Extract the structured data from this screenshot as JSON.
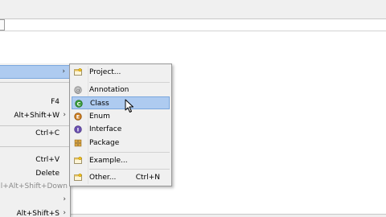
{
  "context_menu": {
    "items": [
      {
        "label": "",
        "has_submenu": true,
        "highlighted": true
      },
      {
        "label": "F4",
        "has_submenu": false
      },
      {
        "label": "Alt+Shift+W",
        "has_submenu": true
      },
      {
        "label": "Ctrl+C",
        "has_submenu": false
      },
      {
        "label": "Ctrl+V",
        "has_submenu": false
      },
      {
        "label": "Delete",
        "has_submenu": false
      },
      {
        "label": "l+Alt+Shift+Down",
        "has_submenu": false
      },
      {
        "label": "",
        "has_submenu": true
      },
      {
        "label": "Alt+Shift+S",
        "has_submenu": true
      }
    ],
    "submenu_arrow": "›"
  },
  "submenu": {
    "items": [
      {
        "label": "Project...",
        "icon": "project-icon",
        "shortcut": ""
      },
      {
        "label": "Annotation",
        "icon": "annotation-icon",
        "shortcut": ""
      },
      {
        "label": "Class",
        "icon": "class-icon",
        "shortcut": "",
        "highlighted": true
      },
      {
        "label": "Enum",
        "icon": "enum-icon",
        "shortcut": ""
      },
      {
        "label": "Interface",
        "icon": "interface-icon",
        "shortcut": ""
      },
      {
        "label": "Package",
        "icon": "package-icon",
        "shortcut": ""
      },
      {
        "label": "Example...",
        "icon": "example-icon",
        "shortcut": ""
      },
      {
        "label": "Other...",
        "icon": "other-icon",
        "shortcut": "Ctrl+N"
      }
    ]
  },
  "colors": {
    "menu_bg": "#f0f0f0",
    "highlight_bg": "#aecbf0",
    "highlight_border": "#7aa7dd",
    "class_icon": "#3a9a3a",
    "enum_icon": "#c87a1e",
    "interface_icon": "#6a4fb0",
    "package_icon": "#b8860b"
  }
}
